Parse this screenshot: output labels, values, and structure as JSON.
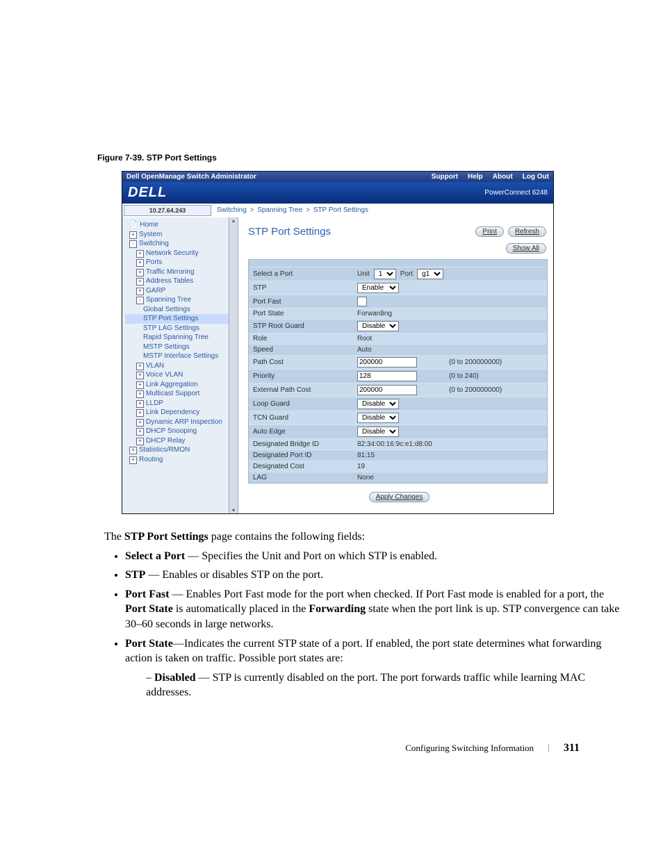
{
  "figure_caption": "Figure 7-39.    STP Port Settings",
  "app": {
    "title": "Dell OpenManage Switch Administrator",
    "toplinks": [
      "Support",
      "Help",
      "About",
      "Log Out"
    ],
    "logo_text": "DELL",
    "device": "PowerConnect 6248",
    "ip": "10.27.64.243",
    "breadcrumb": [
      "Switching",
      "Spanning Tree",
      "STP Port Settings"
    ]
  },
  "sidebar": {
    "items": [
      {
        "lvl": "n1",
        "exp": "",
        "label": "Home",
        "icon": "📄"
      },
      {
        "lvl": "n1",
        "exp": "+",
        "label": "System"
      },
      {
        "lvl": "n1",
        "exp": "-",
        "label": "Switching"
      },
      {
        "lvl": "n2",
        "exp": "+",
        "label": "Network Security"
      },
      {
        "lvl": "n2",
        "exp": "+",
        "label": "Ports"
      },
      {
        "lvl": "n2",
        "exp": "+",
        "label": "Traffic Mirroring"
      },
      {
        "lvl": "n2",
        "exp": "+",
        "label": "Address Tables"
      },
      {
        "lvl": "n2",
        "exp": "+",
        "label": "GARP"
      },
      {
        "lvl": "n2",
        "exp": "-",
        "label": "Spanning Tree"
      },
      {
        "lvl": "n3",
        "exp": "",
        "label": "Global Settings"
      },
      {
        "lvl": "n3",
        "exp": "",
        "label": "STP Port Settings",
        "sel": true
      },
      {
        "lvl": "n3",
        "exp": "",
        "label": "STP LAG Settings"
      },
      {
        "lvl": "n3",
        "exp": "",
        "label": "Rapid Spanning Tree"
      },
      {
        "lvl": "n3",
        "exp": "",
        "label": "MSTP Settings"
      },
      {
        "lvl": "n3",
        "exp": "",
        "label": "MSTP Interface Settings"
      },
      {
        "lvl": "n2",
        "exp": "+",
        "label": "VLAN"
      },
      {
        "lvl": "n2",
        "exp": "+",
        "label": "Voice VLAN"
      },
      {
        "lvl": "n2",
        "exp": "+",
        "label": "Link Aggregation"
      },
      {
        "lvl": "n2",
        "exp": "+",
        "label": "Multicast Support"
      },
      {
        "lvl": "n2",
        "exp": "+",
        "label": "LLDP"
      },
      {
        "lvl": "n2",
        "exp": "+",
        "label": "Link Dependency"
      },
      {
        "lvl": "n2",
        "exp": "+",
        "label": "Dynamic ARP Inspection"
      },
      {
        "lvl": "n2",
        "exp": "+",
        "label": "DHCP Snooping"
      },
      {
        "lvl": "n2",
        "exp": "+",
        "label": "DHCP Relay"
      },
      {
        "lvl": "n1",
        "exp": "+",
        "label": "Statistics/RMON"
      },
      {
        "lvl": "n1",
        "exp": "+",
        "label": "Routing"
      }
    ]
  },
  "pane": {
    "title": "STP Port Settings",
    "print": "Print",
    "refresh": "Refresh",
    "showall": "Show All",
    "apply": "Apply Changes"
  },
  "form": {
    "select_a_port": {
      "label": "Select a Port",
      "unit_label": "Unit",
      "unit_value": "1",
      "port_label": "Port",
      "port_value": "g1"
    },
    "stp": {
      "label": "STP",
      "value": "Enable"
    },
    "port_fast": {
      "label": "Port Fast"
    },
    "port_state": {
      "label": "Port State",
      "value": "Forwarding"
    },
    "stp_root_guard": {
      "label": "STP Root Guard",
      "value": "Disable"
    },
    "role": {
      "label": "Role",
      "value": "Root"
    },
    "speed": {
      "label": "Speed",
      "value": "Auto"
    },
    "path_cost": {
      "label": "Path Cost",
      "value": "200000",
      "hint": "(0 to 200000000)"
    },
    "priority": {
      "label": "Priority",
      "value": "128",
      "hint": "(0 to 240)"
    },
    "ext_path_cost": {
      "label": "External Path Cost",
      "value": "200000",
      "hint": "(0 to 200000000)"
    },
    "loop_guard": {
      "label": "Loop Guard",
      "value": "Disable"
    },
    "tcn_guard": {
      "label": "TCN Guard",
      "value": "Disable"
    },
    "auto_edge": {
      "label": "Auto Edge",
      "value": "Disable"
    },
    "des_bridge": {
      "label": "Designated Bridge ID",
      "value": "82:34:00:16:9c:e1:d8:00"
    },
    "des_port": {
      "label": "Designated Port ID",
      "value": "81:15"
    },
    "des_cost": {
      "label": "Designated Cost",
      "value": "19"
    },
    "lag": {
      "label": "LAG",
      "value": "None"
    }
  },
  "body": {
    "intro_pre": "The ",
    "intro_bold": "STP Port Settings",
    "intro_post": " page contains the following fields:",
    "b1_name": "Select a Port",
    "b1_text": " — Specifies the Unit and Port on which STP is enabled.",
    "b2_name": "STP",
    "b2_text": " — Enables or disables STP on the port.",
    "b3_name": "Port Fast",
    "b3_t1": " — Enables Port Fast mode for the port when checked. If Port Fast mode is enabled for a port, the ",
    "b3_bold2": "Port State",
    "b3_t2": " is automatically placed in the ",
    "b3_bold3": "Forwarding",
    "b3_t3": " state when the port link is up. STP convergence can take 30–60 seconds in large networks.",
    "b4_name": "Port State",
    "b4_t1": "—Indicates the current STP state of a port. If enabled, the port state determines what forwarding action is taken on traffic. Possible port states are:",
    "b4_sub_name": "Disabled",
    "b4_sub_text": " — STP is currently disabled on the port. The port forwards traffic while learning MAC addresses."
  },
  "footer": {
    "section": "Configuring Switching Information",
    "page": "311"
  }
}
